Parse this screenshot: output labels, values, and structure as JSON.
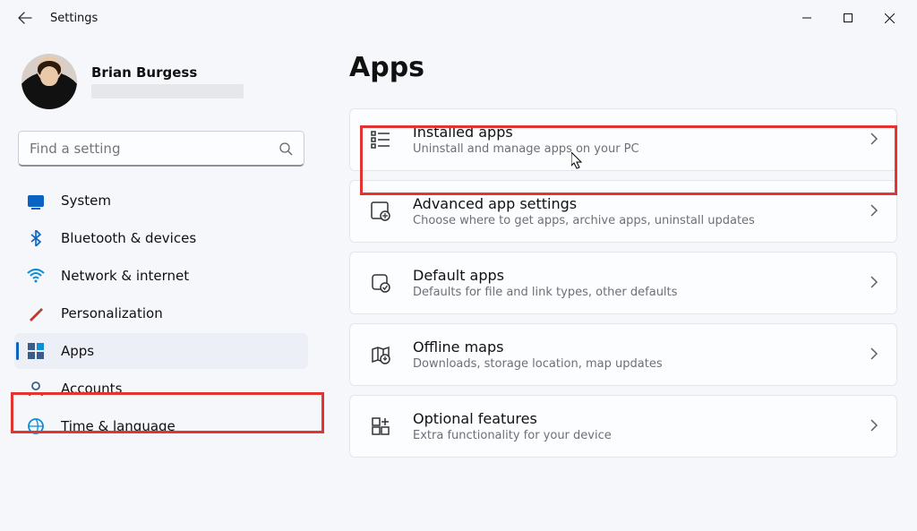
{
  "window": {
    "title": "Settings"
  },
  "profile": {
    "name": "Brian Burgess"
  },
  "search": {
    "placeholder": "Find a setting"
  },
  "nav": {
    "items": [
      {
        "label": "System"
      },
      {
        "label": "Bluetooth & devices"
      },
      {
        "label": "Network & internet"
      },
      {
        "label": "Personalization"
      },
      {
        "label": "Apps"
      },
      {
        "label": "Accounts"
      },
      {
        "label": "Time & language"
      }
    ]
  },
  "page": {
    "title": "Apps"
  },
  "cards": [
    {
      "title": "Installed apps",
      "sub": "Uninstall and manage apps on your PC"
    },
    {
      "title": "Advanced app settings",
      "sub": "Choose where to get apps, archive apps, uninstall updates"
    },
    {
      "title": "Default apps",
      "sub": "Defaults for file and link types, other defaults"
    },
    {
      "title": "Offline maps",
      "sub": "Downloads, storage location, map updates"
    },
    {
      "title": "Optional features",
      "sub": "Extra functionality for your device"
    }
  ]
}
